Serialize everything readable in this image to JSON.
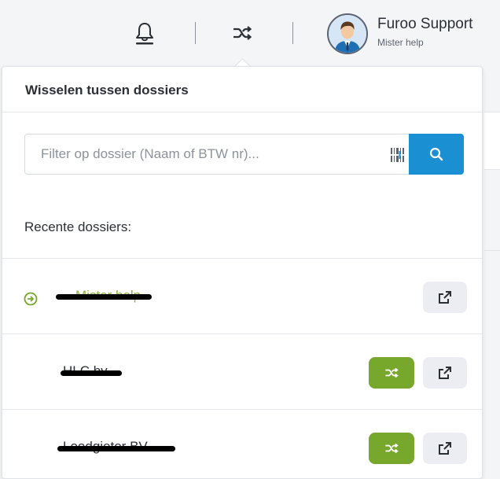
{
  "header": {
    "user": {
      "name": "Furoo Support",
      "subtitle": "Mister help"
    },
    "icons": [
      "bell-icon",
      "shuffle-icon",
      "avatar"
    ]
  },
  "panel": {
    "title": "Wisselen tussen dossiers",
    "search": {
      "placeholder": "Filter op dossier (Naam of BTW nr)...",
      "value": ""
    },
    "recent_label": "Recente dossiers:",
    "dossiers": [
      {
        "name": "Mister help",
        "current": true,
        "redacted": true
      },
      {
        "name": "HLC bv",
        "current": false,
        "redacted": true
      },
      {
        "name": "Loodgieter BV",
        "current": false,
        "redacted": true
      }
    ]
  },
  "colors": {
    "accent_blue": "#1a90d2",
    "accent_green": "#77a72b",
    "current_text": "#8bb33c",
    "open_button_bg": "#ebedf2"
  }
}
